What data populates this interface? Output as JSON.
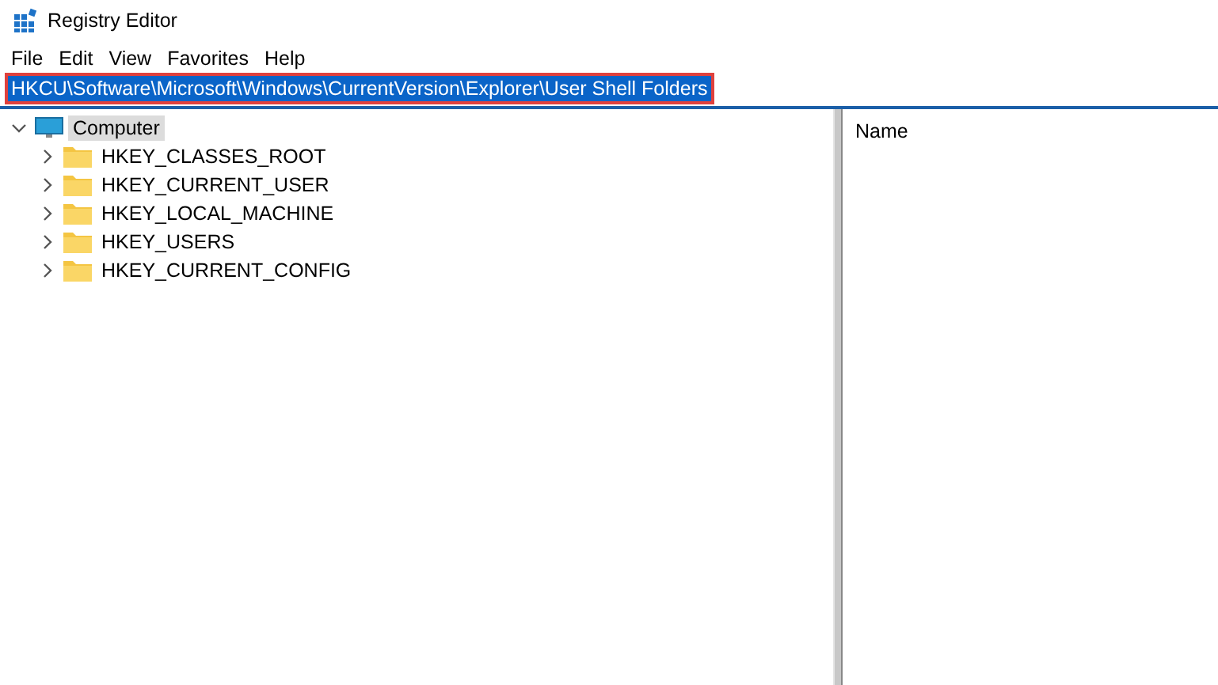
{
  "window": {
    "title": "Registry Editor"
  },
  "menu": [
    "File",
    "Edit",
    "View",
    "Favorites",
    "Help"
  ],
  "address": {
    "value": "HKCU\\Software\\Microsoft\\Windows\\CurrentVersion\\Explorer\\User Shell Folders",
    "selected": true,
    "highlighted": true
  },
  "tree": [
    {
      "label": "Computer",
      "kind": "computer",
      "expanded": true,
      "selected": true,
      "children": [
        {
          "label": "HKEY_CLASSES_ROOT",
          "kind": "folder",
          "expanded": false,
          "selected": false
        },
        {
          "label": "HKEY_CURRENT_USER",
          "kind": "folder",
          "expanded": false,
          "selected": false
        },
        {
          "label": "HKEY_LOCAL_MACHINE",
          "kind": "folder",
          "expanded": false,
          "selected": false
        },
        {
          "label": "HKEY_USERS",
          "kind": "folder",
          "expanded": false,
          "selected": false
        },
        {
          "label": "HKEY_CURRENT_CONFIG",
          "kind": "folder",
          "expanded": false,
          "selected": false
        }
      ]
    }
  ],
  "list": {
    "columns": [
      "Name"
    ]
  }
}
